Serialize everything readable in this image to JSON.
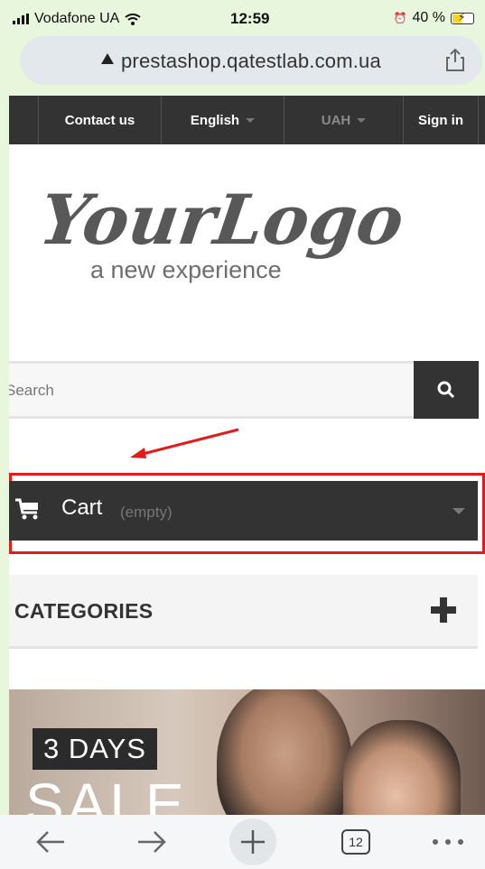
{
  "statusbar": {
    "carrier": "Vodafone UA",
    "time": "12:59",
    "battery": "40 %"
  },
  "browser": {
    "url": "prestashop.qatestlab.com.ua",
    "tabs_count": "12"
  },
  "topnav": {
    "contact": "Contact us",
    "language": "English",
    "currency": "UAH",
    "signin": "Sign in"
  },
  "logo": {
    "title": "YourLogo",
    "tagline": "a new experience"
  },
  "search": {
    "placeholder": "Search"
  },
  "cart": {
    "label": "Cart",
    "status": "(empty)"
  },
  "categories": {
    "title": "CATEGORIES"
  },
  "banner": {
    "days": "3 DAYS",
    "sale": "SALE"
  },
  "colors": {
    "nav_bg": "#333333",
    "highlight": "#e21b1b",
    "page_bg": "#e8f7dc"
  }
}
